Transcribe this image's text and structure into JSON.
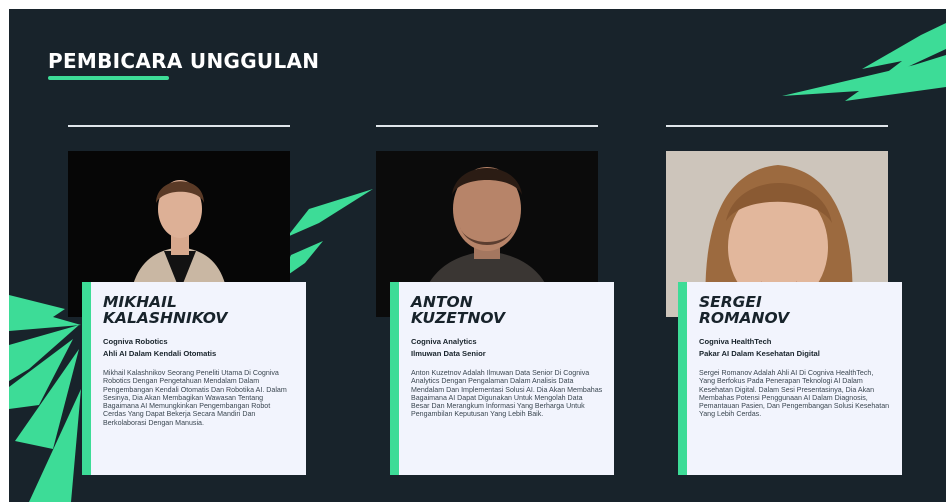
{
  "slide": {
    "title": "PEMBICARA UNGGULAN",
    "colors": {
      "background": "#18232b",
      "accent": "#3ddc97",
      "card": "#f2f4fd"
    }
  },
  "speakers": [
    {
      "name": "MIKHAIL\nKALASHNIKOV",
      "company": "Cogniva Robotics",
      "role": "Ahli AI Dalam Kendali Otomatis",
      "bio": "Mikhail Kalashnikov Seorang Peneliti Utama Di Cogniva Robotics Dengan Pengetahuan Mendalam Dalam Pengembangan Kendali Otomatis Dan Robotika AI. Dalam Sesinya, Dia Akan Membagikan Wawasan Tentang Bagaimana AI Memungkinkan Pengembangan Robot Cerdas Yang Dapat Bekerja Secara Mandiri Dan Berkolaborasi Dengan Manusia."
    },
    {
      "name": "ANTON\nKUZETNOV",
      "company": "Cogniva Analytics",
      "role": "Ilmuwan Data Senior",
      "bio": "Anton Kuzetnov Adalah Ilmuwan Data Senior Di Cogniva Analytics Dengan Pengalaman Dalam Analisis Data Mendalam Dan Implementasi Solusi AI. Dia Akan Membahas Bagaimana AI Dapat Digunakan Untuk Mengolah Data Besar Dan Merangkum Informasi Yang Berharga Untuk Pengambilan Keputusan Yang Lebih Baik."
    },
    {
      "name": "SERGEI\nROMANOV",
      "company": "Cogniva HealthTech",
      "role": "Pakar AI Dalam Kesehatan Digital",
      "bio": "Sergei Romanov Adalah Ahli AI Di Cogniva HealthTech, Yang Berfokus Pada Penerapan Teknologi AI Dalam Kesehatan Digital. Dalam Sesi Presentasinya, Dia Akan Membahas Potensi Penggunaan AI Dalam Diagnosis, Pemantauan Pasien, Dan Pengembangan Solusi Kesehatan Yang Lebih Cerdas."
    }
  ]
}
